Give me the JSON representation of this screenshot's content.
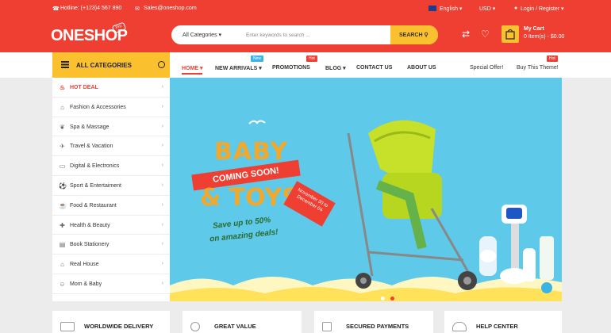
{
  "topbar": {
    "hotline": "Hotline: (+123)4 567 890",
    "email": "Sales@oneshop.com",
    "language": "English",
    "currency": "USD",
    "account": "Login / Register"
  },
  "header": {
    "logo": "ONESHOP",
    "logo_tag": "Pro",
    "search_category": "All Categories",
    "search_placeholder": "Enter keywords to search ...",
    "search_button": "SEARCH",
    "cart_title": "My Cart",
    "cart_summary": "0 Item(s) - $0.00"
  },
  "nav": {
    "all_categories": "ALL CATEGORIES",
    "items": [
      {
        "label": "HOME",
        "dropdown": true
      },
      {
        "label": "NEW ARRIVALS",
        "dropdown": true,
        "badge": "New"
      },
      {
        "label": "PROMOTIONS",
        "badge": "Hot"
      },
      {
        "label": "BLOG",
        "dropdown": true
      },
      {
        "label": "CONTACT US"
      },
      {
        "label": "ABOUT US"
      }
    ],
    "right": [
      "Special Offer!",
      "Buy This Theme!"
    ],
    "right_badge": "Hot"
  },
  "sidebar": [
    {
      "label": "HOT DEAL",
      "icon": "flame-icon"
    },
    {
      "label": "Fashion & Accessories",
      "icon": "shirt-icon"
    },
    {
      "label": "Spa & Massage",
      "icon": "spa-icon"
    },
    {
      "label": "Travel & Vacation",
      "icon": "travel-icon"
    },
    {
      "label": "Digital & Electronics",
      "icon": "monitor-icon"
    },
    {
      "label": "Sport & Entertaiment",
      "icon": "sport-icon"
    },
    {
      "label": "Food & Restaurant",
      "icon": "food-icon"
    },
    {
      "label": "Health & Beauty",
      "icon": "health-icon"
    },
    {
      "label": "Book Stationery",
      "icon": "book-icon"
    },
    {
      "label": "Real House",
      "icon": "house-icon"
    },
    {
      "label": "Mom & Baby",
      "icon": "baby-icon"
    }
  ],
  "banner": {
    "title1": "BABY",
    "ribbon": "COMING SOON!",
    "title2": "& TOYS",
    "date": "November 30 to December 04",
    "promo1": "Save up to 50%",
    "promo2": "on amazing deals!"
  },
  "features": [
    "WORLDWIDE DELIVERY",
    "GREAT VALUE",
    "SECURED PAYMENTS",
    "HELP CENTER"
  ],
  "colors": {
    "primary": "#ee3f32",
    "accent": "#fbc02d",
    "banner_sky": "#5ec9e8"
  }
}
